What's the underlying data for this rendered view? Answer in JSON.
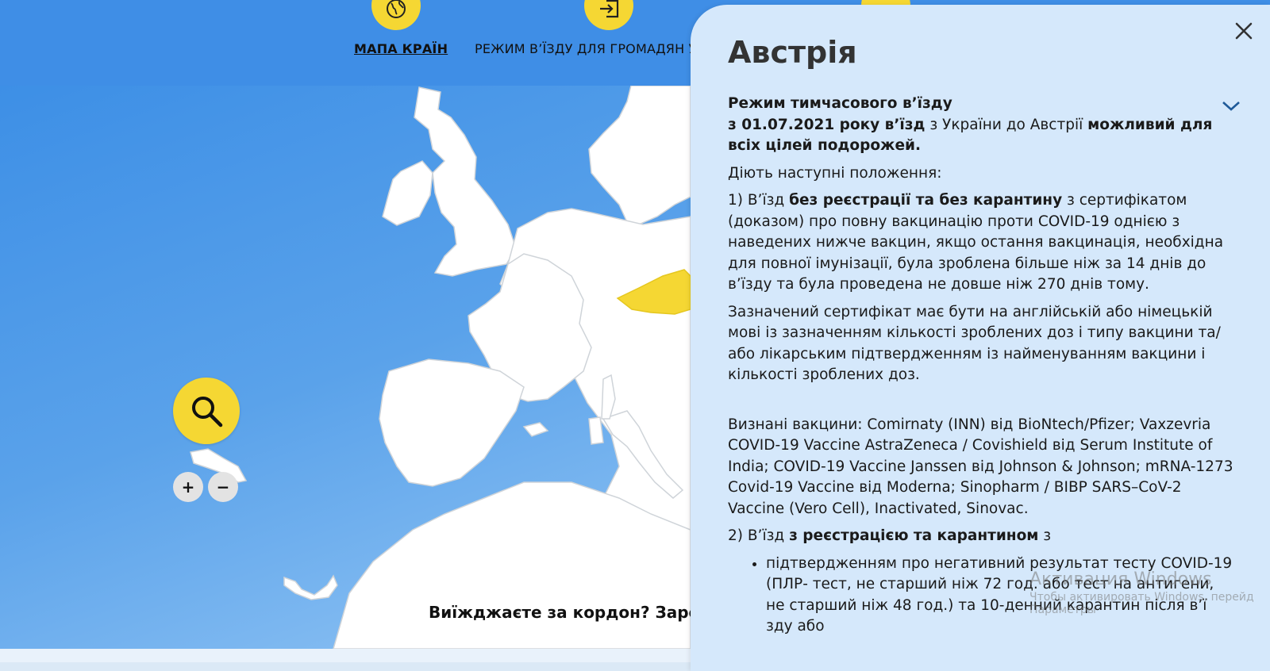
{
  "nav": {
    "items": [
      {
        "label": "МАПА КРАЇН",
        "icon": "globe-icon",
        "active": true
      },
      {
        "label": "РЕЖИМ В’ЇЗДУ ДЛЯ ГРОМАДЯН У",
        "icon": "enter-icon",
        "active": false
      },
      {
        "label": "",
        "icon": "person-icon",
        "active": false
      }
    ]
  },
  "map": {
    "search_icon": "search-icon",
    "zoom_in_label": "+",
    "zoom_out_label": "−",
    "register_banner": "Виїжджаєте за кордон? Зарєєст",
    "highlight_color": "#f5d733",
    "land_color": "#ffffff",
    "sea_color": "#3d8fe6"
  },
  "panel": {
    "close_icon": "close-icon",
    "chevron_icon": "chevron-down-icon",
    "country": "Австрія",
    "section_title": "Режим тимчасового в’їзду",
    "p1_b1": "з 01.07.2021 року в’їзд",
    "p1_t1": " з України до Австрії ",
    "p1_b2": "можливий для всіх цілей подорожей.",
    "p2": "Діють наступні положення:",
    "p3_t1": "1) В’їзд ",
    "p3_b1": "без реєстрації та без карантину",
    "p3_t2": " з сертифікатом (доказом) про повну вакцинацію проти COVID-19 однією з наведених нижче вакцин, якщо остання вакцинація, необхідна для повної імунізації, була зроблена більше ніж за 14 днів до в’їзду  та була проведена не довше ніж 270 днів тому.",
    "p4": "Зазначений сертифікат має бути на англійській або німецькій мові із зазначенням кількості зроблених доз і типу вакцини та/або лікарським підтвердженням із найменуванням вакцини і кількості зроблених доз.",
    "p5": "Визнані вакцини: Comirnaty (INN) від BioNtech/Pfizer; Vaxzevria COVID-19 Vaccine AstraZeneca / Covishield від Serum Institute of India; COVID-19 Vaccine Janssen від Johnson & Johnson; mRNA-1273 Covid-19 Vaccine від Moderna; Sinopharm / BIBP SARS–CoV-2 Vaccine (Vero Cell), Inactivated, Sinovac.",
    "p6_t1": "2) В’їзд ",
    "p6_b1": "з реєстрацією та карантином",
    "p6_t2": " з",
    "li1": "підтвердженням про негативний результат тесту COVID-19 (ПЛР- тест, не старший ніж 72 год. або тест на антигени, не старший ніж 48 год.) та 10-денний карантин після в’ї зду або"
  },
  "watermark": {
    "line1": "Активация Windows",
    "line2": "Чтобы активировать Windows, перейд",
    "line3": "Параметры"
  }
}
